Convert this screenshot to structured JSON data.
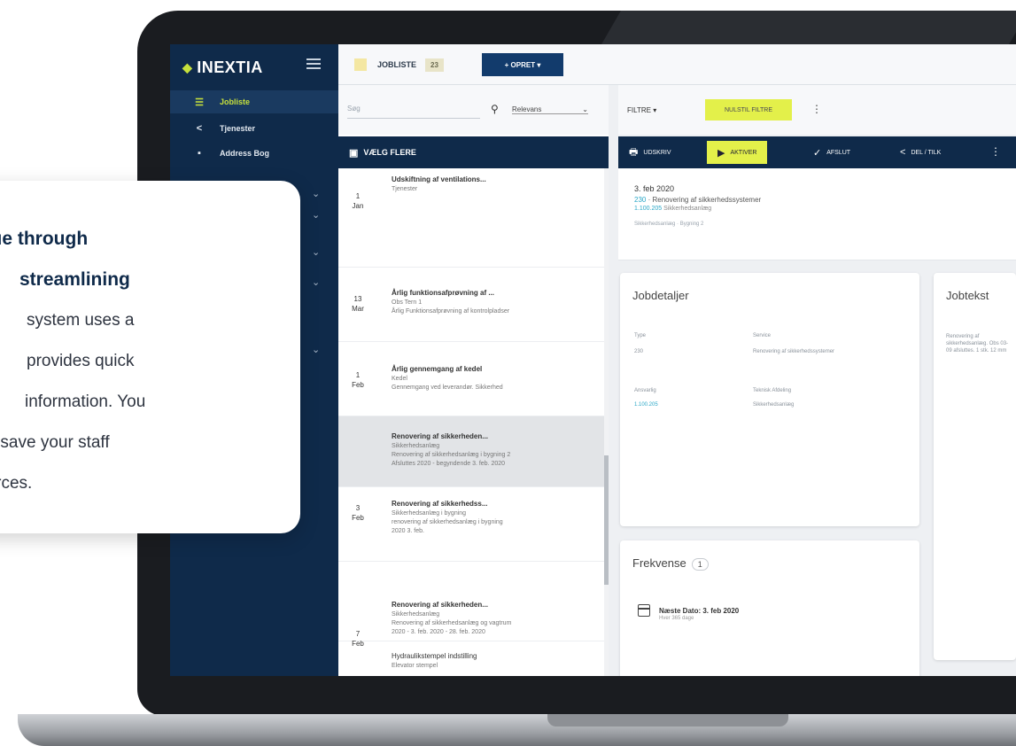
{
  "app": {
    "brand": "INEXTIA",
    "colors": {
      "navy": "#0f2a4a",
      "accent_lime": "#e3f04a",
      "teal_link": "#29a7c7",
      "red_marker": "#e04848"
    }
  },
  "sidebar": {
    "items": [
      {
        "icon": "list-icon",
        "label": "Jobliste",
        "active": true
      },
      {
        "icon": "share-icon",
        "label": "Tjenester"
      },
      {
        "icon": "book-icon",
        "label": "Address Bog"
      }
    ]
  },
  "topbar": {
    "tab_label": "JOBLISTE",
    "tab_count": "23",
    "create_button": "+ OPRET ▾"
  },
  "joblist": {
    "search_placeholder": "Søg",
    "sort_label": "Relevans",
    "header_label": "VÆLG FLERE",
    "rows": [
      {
        "day": "1",
        "month": "Jan",
        "title": "Udskiftning af ventilations...",
        "line1": "Tjenester",
        "line2": "",
        "line3": ""
      },
      {
        "day": "13",
        "month": "Mar",
        "title": "Årlig funktionsafprøvning af ...",
        "line1": "Obs Tern 1",
        "line2": "Årlig Funktionsafprøvning af kontrolpladser",
        "line3": ""
      },
      {
        "day": "1",
        "month": "Feb",
        "title": "Årlig gennemgang af kedel",
        "line1": "Kedel",
        "line2": "Gennemgang ved leverandør. Sikkerhed",
        "line3": ""
      },
      {
        "day": "",
        "month": "",
        "title": "Renovering af sikkerheden...",
        "line1": "Sikkerhedsanlæg",
        "line2": "Renovering af sikkerhedsanlæg i bygning 2",
        "line3": "Afsluttes 2020 - begyndende 3. feb. 2020"
      },
      {
        "day": "3",
        "month": "Feb",
        "title": "Renovering af sikkerhedss...",
        "line1": "Sikkerhedsanlæg i bygning",
        "line2": "renovering af sikkerhedsanlæg i bygning",
        "line3": "2020 3. feb."
      },
      {
        "day": "",
        "month": "",
        "title": "Renovering af sikkerheden...",
        "line1": "Sikkerhedsanlæg",
        "line2": "Renovering af sikkerhedsanlæg og vagtrum",
        "line3": "2020 - 3. feb. 2020 - 28. feb. 2020"
      },
      {
        "day": "7",
        "month": "Feb",
        "title": "Hydraulikstempel indstilling",
        "line1": "Elevator stempel",
        "line2": "",
        "line3": ""
      }
    ]
  },
  "detail": {
    "filter_label": "FILTRE ▾",
    "reset_filters": "NULSTIL FILTRE",
    "actions": [
      {
        "icon": "print-icon",
        "label": "UDSKRIV"
      },
      {
        "icon": "play-icon",
        "label": "AKTIVER",
        "highlight": true
      },
      {
        "icon": "check-icon",
        "label": "AFSLUT"
      },
      {
        "icon": "share-icon",
        "label": "DEL / TILK"
      }
    ],
    "summary": {
      "date": "3. feb 2020",
      "code": "230",
      "title": "Renovering af sikkerhedssystemer",
      "ref": "1.100.205",
      "ref_label": "Sikkerhedsanlæg",
      "meta": "Sikkerhedsanlæg · Bygning 2"
    },
    "jobdetaljer": {
      "title": "Jobdetaljer",
      "fields": [
        {
          "label": "Type",
          "value": "Service"
        },
        {
          "label": "230",
          "value": "Renovering af sikkerhedssystemer"
        },
        {
          "label": "Ansvarlig",
          "value": "Teknisk Afdeling"
        },
        {
          "label": "1.100.205",
          "value": "Sikkerhedsanlæg"
        }
      ]
    },
    "jobtekst": {
      "title": "Jobtekst",
      "text": "Renovering af sikkerhedsanlæg. Obs 03-09 afsluttes. 1 stk. 12 mm"
    },
    "frekvens": {
      "title": "Frekvense",
      "count": "1",
      "next_date": "Næste Dato: 3. feb 2020",
      "next_sub": "Hver 365 dage"
    }
  },
  "overlay": {
    "heading_line1": "alue through",
    "heading_line2": "streamlining",
    "body_line1": "system uses a",
    "body_line2": "provides quick",
    "body_line3": "information. You",
    "body_line4": "nd save your staff",
    "body_line5": "ources."
  }
}
